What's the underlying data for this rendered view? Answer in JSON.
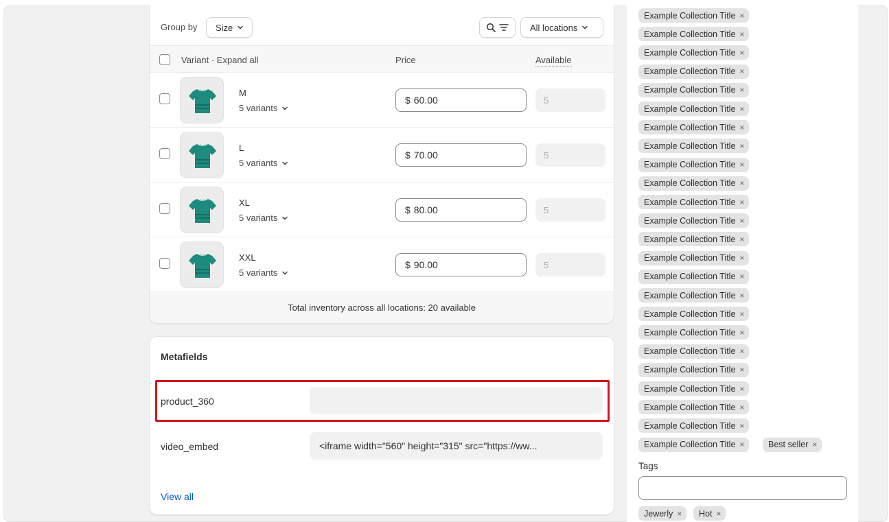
{
  "variants": {
    "group_by_label": "Group by",
    "group_by_value": "Size",
    "location_filter": "All locations",
    "columns": {
      "variant": "Variant · Expand all",
      "price": "Price",
      "available": "Available"
    },
    "rows": [
      {
        "name": "M",
        "count": "5 variants",
        "currency": "$",
        "price": "60.00",
        "available": "5"
      },
      {
        "name": "L",
        "count": "5 variants",
        "currency": "$",
        "price": "70.00",
        "available": "5"
      },
      {
        "name": "XL",
        "count": "5 variants",
        "currency": "$",
        "price": "80.00",
        "available": "5"
      },
      {
        "name": "XXL",
        "count": "5 variants",
        "currency": "$",
        "price": "90.00",
        "available": "5"
      }
    ],
    "total_inventory": "Total inventory across all locations: 20 available",
    "product_color": "#1f8a7e"
  },
  "metafields": {
    "title": "Metafields",
    "fields": [
      {
        "label": "product_360",
        "value": ""
      },
      {
        "label": "video_embed",
        "value": "<iframe width=\"560\" height=\"315\" src=\"https://ww..."
      }
    ],
    "view_all": "View all",
    "highlight_color": "#d4151c"
  },
  "collections": {
    "chips": [
      "Example Collection Title",
      "Example Collection Title",
      "Example Collection Title",
      "Example Collection Title",
      "Example Collection Title",
      "Example Collection Title",
      "Example Collection Title",
      "Example Collection Title",
      "Example Collection Title",
      "Example Collection Title",
      "Example Collection Title",
      "Example Collection Title",
      "Example Collection Title",
      "Example Collection Title",
      "Example Collection Title",
      "Example Collection Title",
      "Example Collection Title",
      "Example Collection Title",
      "Example Collection Title",
      "Example Collection Title",
      "Example Collection Title",
      "Example Collection Title",
      "Example Collection Title",
      "Example Collection Title"
    ],
    "extra_chip": "Best seller",
    "remove_glyph": "×"
  },
  "tags": {
    "label": "Tags",
    "input_value": "",
    "chips": [
      "Jewerly",
      "Hot"
    ]
  }
}
